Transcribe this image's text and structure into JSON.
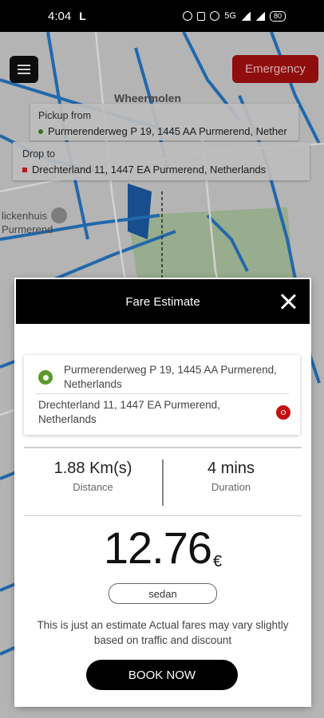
{
  "status_bar": {
    "time": "4:04",
    "network": "5G",
    "battery": "80"
  },
  "map": {
    "emergency_label": "Emergency",
    "labels": {
      "area": "Wheermolen",
      "poi_1": "lickenhuis",
      "poi_2": "Purmerend"
    }
  },
  "pickup_card": {
    "title": "Pickup from",
    "address": "Purmerenderweg P 19, 1445 AA Purmerend, Nether"
  },
  "drop_card": {
    "title": "Drop to",
    "address": "Drechterland 11, 1447 EA Purmerend, Netherlands"
  },
  "modal": {
    "title": "Fare Estimate",
    "pickup_address": "Purmerenderweg P 19, 1445 AA Purmerend, Netherlands",
    "drop_address": "Drechterland 11, 1447 EA Purmerend, Netherlands",
    "distance_value": "1.88 Km(s)",
    "distance_label": "Distance",
    "duration_value": "4 mins",
    "duration_label": "Duration",
    "fare_amount": "12.76",
    "currency": "€",
    "vehicle_type": "sedan",
    "note": "This is just an estimate Actual fares may vary slightly based on traffic and discount",
    "book_label": "BOOK NOW"
  },
  "colors": {
    "emergency": "#b01010",
    "pickup_pin": "#5a9a2a",
    "drop_pin": "#c41010",
    "header": "#000000"
  }
}
